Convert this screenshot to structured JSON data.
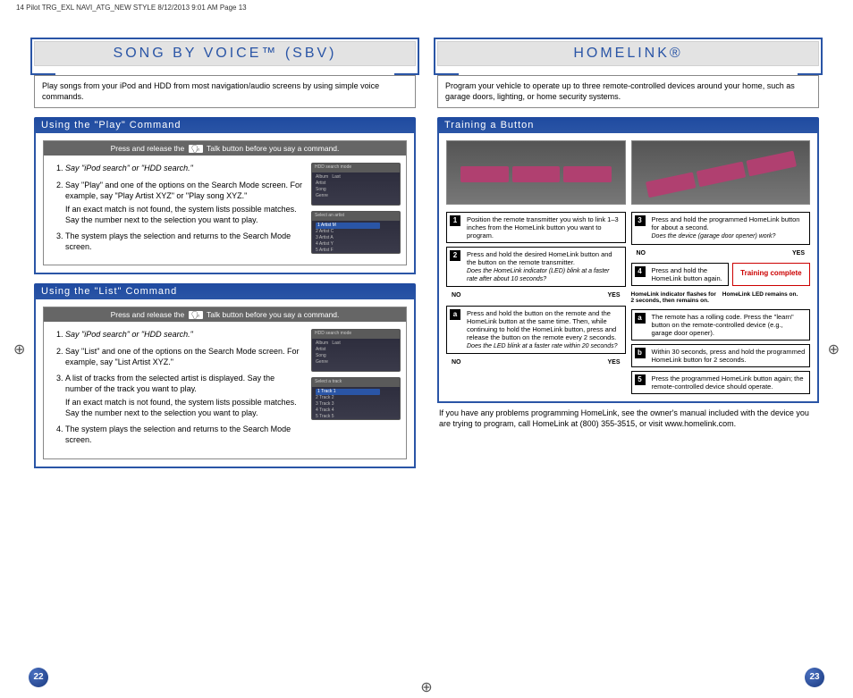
{
  "meta": {
    "header": "14 Pilot TRG_EXL NAVI_ATG_NEW STYLE  8/12/2013  9:01 AM  Page 13"
  },
  "left": {
    "title": "SONG BY VOICE™ (SBV)",
    "intro": "Play songs from your iPod and HDD from most navigation/audio screens by using simple voice commands.",
    "play": {
      "header": "Using the \"Play\" Command",
      "bar_pre": "Press and release the",
      "bar_post": "Talk button before you say a command.",
      "step1": "Say \"iPod search\" or \"HDD search.\"",
      "step2": "Say \"Play\" and one of the options on the Search Mode screen. For example, say \"Play Artist XYZ\" or \"Play song XYZ.\"",
      "step2_note": "If an exact match is not found, the system lists possible matches. Say the number next to the selection you want to play.",
      "step3": "The system plays the selection and returns to the Search Mode screen.",
      "screen1_title": "HDD search mode",
      "screen2_title": "Select an artist"
    },
    "list": {
      "header": "Using the \"List\" Command",
      "bar_pre": "Press and release the",
      "bar_post": "Talk button before you say a command.",
      "step1": "Say \"iPod search\" or \"HDD search.\"",
      "step2": "Say \"List\" and one of the options on the Search Mode screen. For example, say \"List Artist XYZ.\"",
      "step3": "A list of tracks from the selected artist is displayed. Say the number of the track you want to play.",
      "step3_note": "If an exact match is not found, the system lists possible matches. Say the number next to the selection you want to play.",
      "step4": "The system plays the selection and returns to the Search Mode screen.",
      "screen1_title": "HDD search mode",
      "screen2_title": "Select a track"
    },
    "page_num": "22"
  },
  "right": {
    "title": "HOMELINK®",
    "intro": "Program your vehicle to operate up to three remote-controlled devices around your home, such as garage doors, lighting, or home security systems.",
    "training_header": "Training a Button",
    "flow": {
      "s1": "Position the remote transmitter you wish to link 1–3 inches from the HomeLink button you want to program.",
      "s2": "Press and hold the desired HomeLink button and the button on the remote transmitter.",
      "s2q": "Does the HomeLink indicator (LED) blink at a faster rate after about 10 seconds?",
      "no": "NO",
      "yes": "YES",
      "sa": "Press and hold the button on the remote and the HomeLink button at the same time. Then, while continuing to hold the HomeLink button, press and release the button on the remote every 2 seconds.",
      "saq": "Does the LED blink at a faster rate within 20 seconds?",
      "s3": "Press and hold the programmed HomeLink button for about a second.",
      "s3q": "Does the device (garage door opener) work?",
      "s4": "Press and hold the HomeLink button again.",
      "complete": "Training complete",
      "note_l": "HomeLink indicator flashes for 2 seconds, then remains on.",
      "note_r": "HomeLink LED remains on.",
      "ra": "The remote has a rolling code. Press the \"learn\" button on the remote-controlled device (e.g., garage door opener).",
      "rb": "Within 30 seconds, press and hold the programmed HomeLink button for 2 seconds.",
      "s5": "Press the programmed HomeLink button again; the remote-controlled device should operate."
    },
    "footer": "If you have any problems programming HomeLink, see the owner's manual included with the device you are trying to program, call HomeLink at (800) 355-3515, or visit www.homelink.com.",
    "page_num": "23"
  }
}
